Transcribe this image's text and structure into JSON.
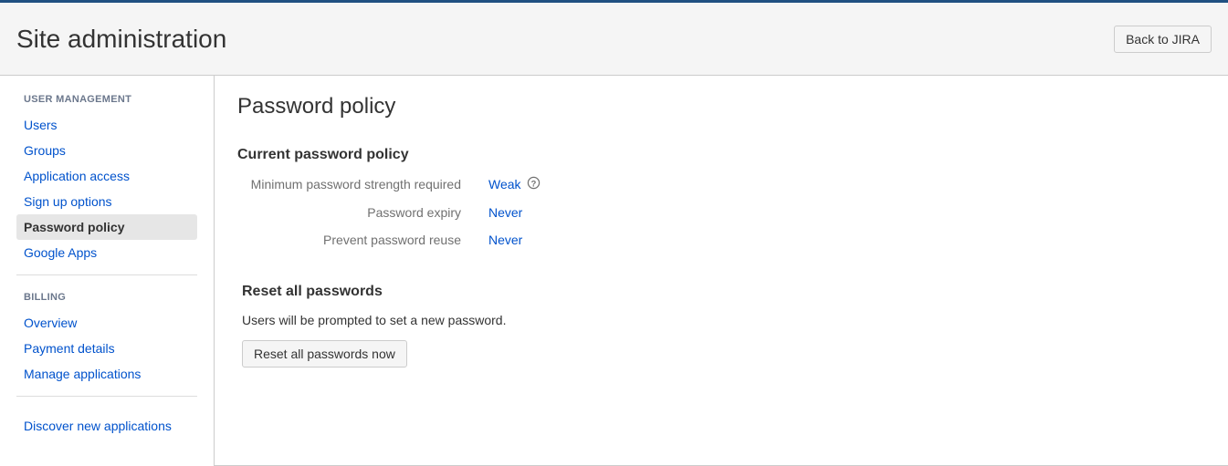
{
  "header": {
    "title": "Site administration",
    "back_button": "Back to JIRA"
  },
  "sidebar": {
    "section1_title": "USER MANAGEMENT",
    "section1_items": [
      "Users",
      "Groups",
      "Application access",
      "Sign up options",
      "Password policy",
      "Google Apps"
    ],
    "section1_active_index": 4,
    "section2_title": "BILLING",
    "section2_items": [
      "Overview",
      "Payment details",
      "Manage applications"
    ],
    "discover_label": "Discover new applications"
  },
  "main": {
    "title": "Password policy",
    "current_heading": "Current password policy",
    "policy": {
      "strength_label": "Minimum password strength required",
      "strength_value": "Weak",
      "expiry_label": "Password expiry",
      "expiry_value": "Never",
      "reuse_label": "Prevent password reuse",
      "reuse_value": "Never"
    },
    "reset_heading": "Reset all passwords",
    "reset_desc": "Users will be prompted to set a new password.",
    "reset_button": "Reset all passwords now"
  }
}
